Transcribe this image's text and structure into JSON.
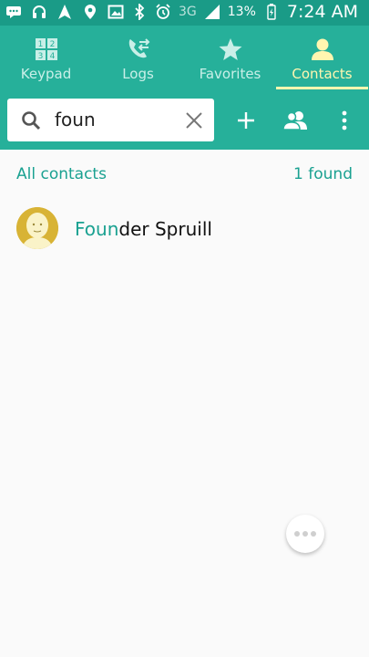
{
  "status_bar": {
    "left_icons": [
      "message-icon",
      "headphones-icon",
      "navigation-icon",
      "location-icon",
      "image-icon"
    ],
    "right_icons": [
      "bluetooth-icon",
      "alarm-icon",
      "signal-icon",
      "battery-icon"
    ],
    "network": "3G",
    "battery": "13%",
    "time": "7:24 AM"
  },
  "tabs": [
    {
      "label": "Keypad",
      "icon": "keypad-icon",
      "active": false
    },
    {
      "label": "Logs",
      "icon": "logs-icon",
      "active": false
    },
    {
      "label": "Favorites",
      "icon": "star-icon",
      "active": false
    },
    {
      "label": "Contacts",
      "icon": "contact-icon",
      "active": true
    }
  ],
  "search": {
    "value": "foun",
    "icon": "search-icon",
    "clear_icon": "close-icon"
  },
  "actions": [
    "add-icon",
    "groups-icon",
    "more-icon"
  ],
  "results_header": {
    "label": "All contacts",
    "count": "1 found"
  },
  "contacts": [
    {
      "match": "Foun",
      "rest": "der Spruill"
    }
  ],
  "colors": {
    "status_bar": "#1a9b87",
    "header": "#26b09a",
    "accent": "#1aa191",
    "active_tab": "#fff6b0"
  }
}
